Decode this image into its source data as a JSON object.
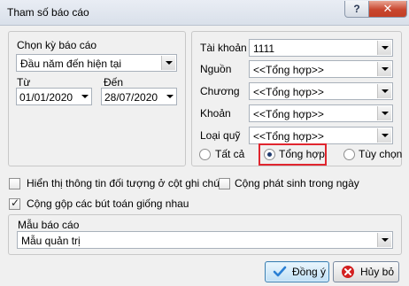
{
  "window": {
    "title": "Tham số báo cáo",
    "help_label": "?",
    "close_label": "✕"
  },
  "period": {
    "label": "Chọn kỳ báo cáo",
    "selected": "Đầu năm đến hiện tại",
    "from_label": "Từ",
    "from_value": "01/01/2020",
    "to_label": "Đến",
    "to_value": "28/07/2020"
  },
  "filters": {
    "account": {
      "label": "Tài khoản",
      "value": "1111"
    },
    "source": {
      "label": "Nguồn",
      "value": "<<Tổng hợp>>"
    },
    "chapter": {
      "label": "Chương",
      "value": "<<Tổng hợp>>"
    },
    "item": {
      "label": "Khoản",
      "value": "<<Tổng hợp>>"
    },
    "fund_type": {
      "label": "Loại quỹ",
      "value": "<<Tổng hợp>>"
    },
    "mode_options": [
      "Tất cả",
      "Tổng hợp",
      "Tùy chọn"
    ],
    "mode_selected": "Tổng hợp"
  },
  "options": {
    "show_object_info": {
      "label": "Hiển thị thông tin đối tượng ở cột ghi chú",
      "checked": false
    },
    "daily_total": {
      "label": "Cộng phát sinh trong ngày",
      "checked": false
    },
    "merge_entries": {
      "label": "Cộng gộp các bút toán giống nhau",
      "checked": true
    }
  },
  "template": {
    "label": "Mẫu báo cáo",
    "value": "Mẫu quản trị"
  },
  "buttons": {
    "ok": "Đồng ý",
    "cancel": "Hủy bỏ"
  },
  "colors": {
    "highlight": "#e0262f",
    "ok_icon": "#2a7fd4",
    "cancel_icon": "#d32020"
  }
}
